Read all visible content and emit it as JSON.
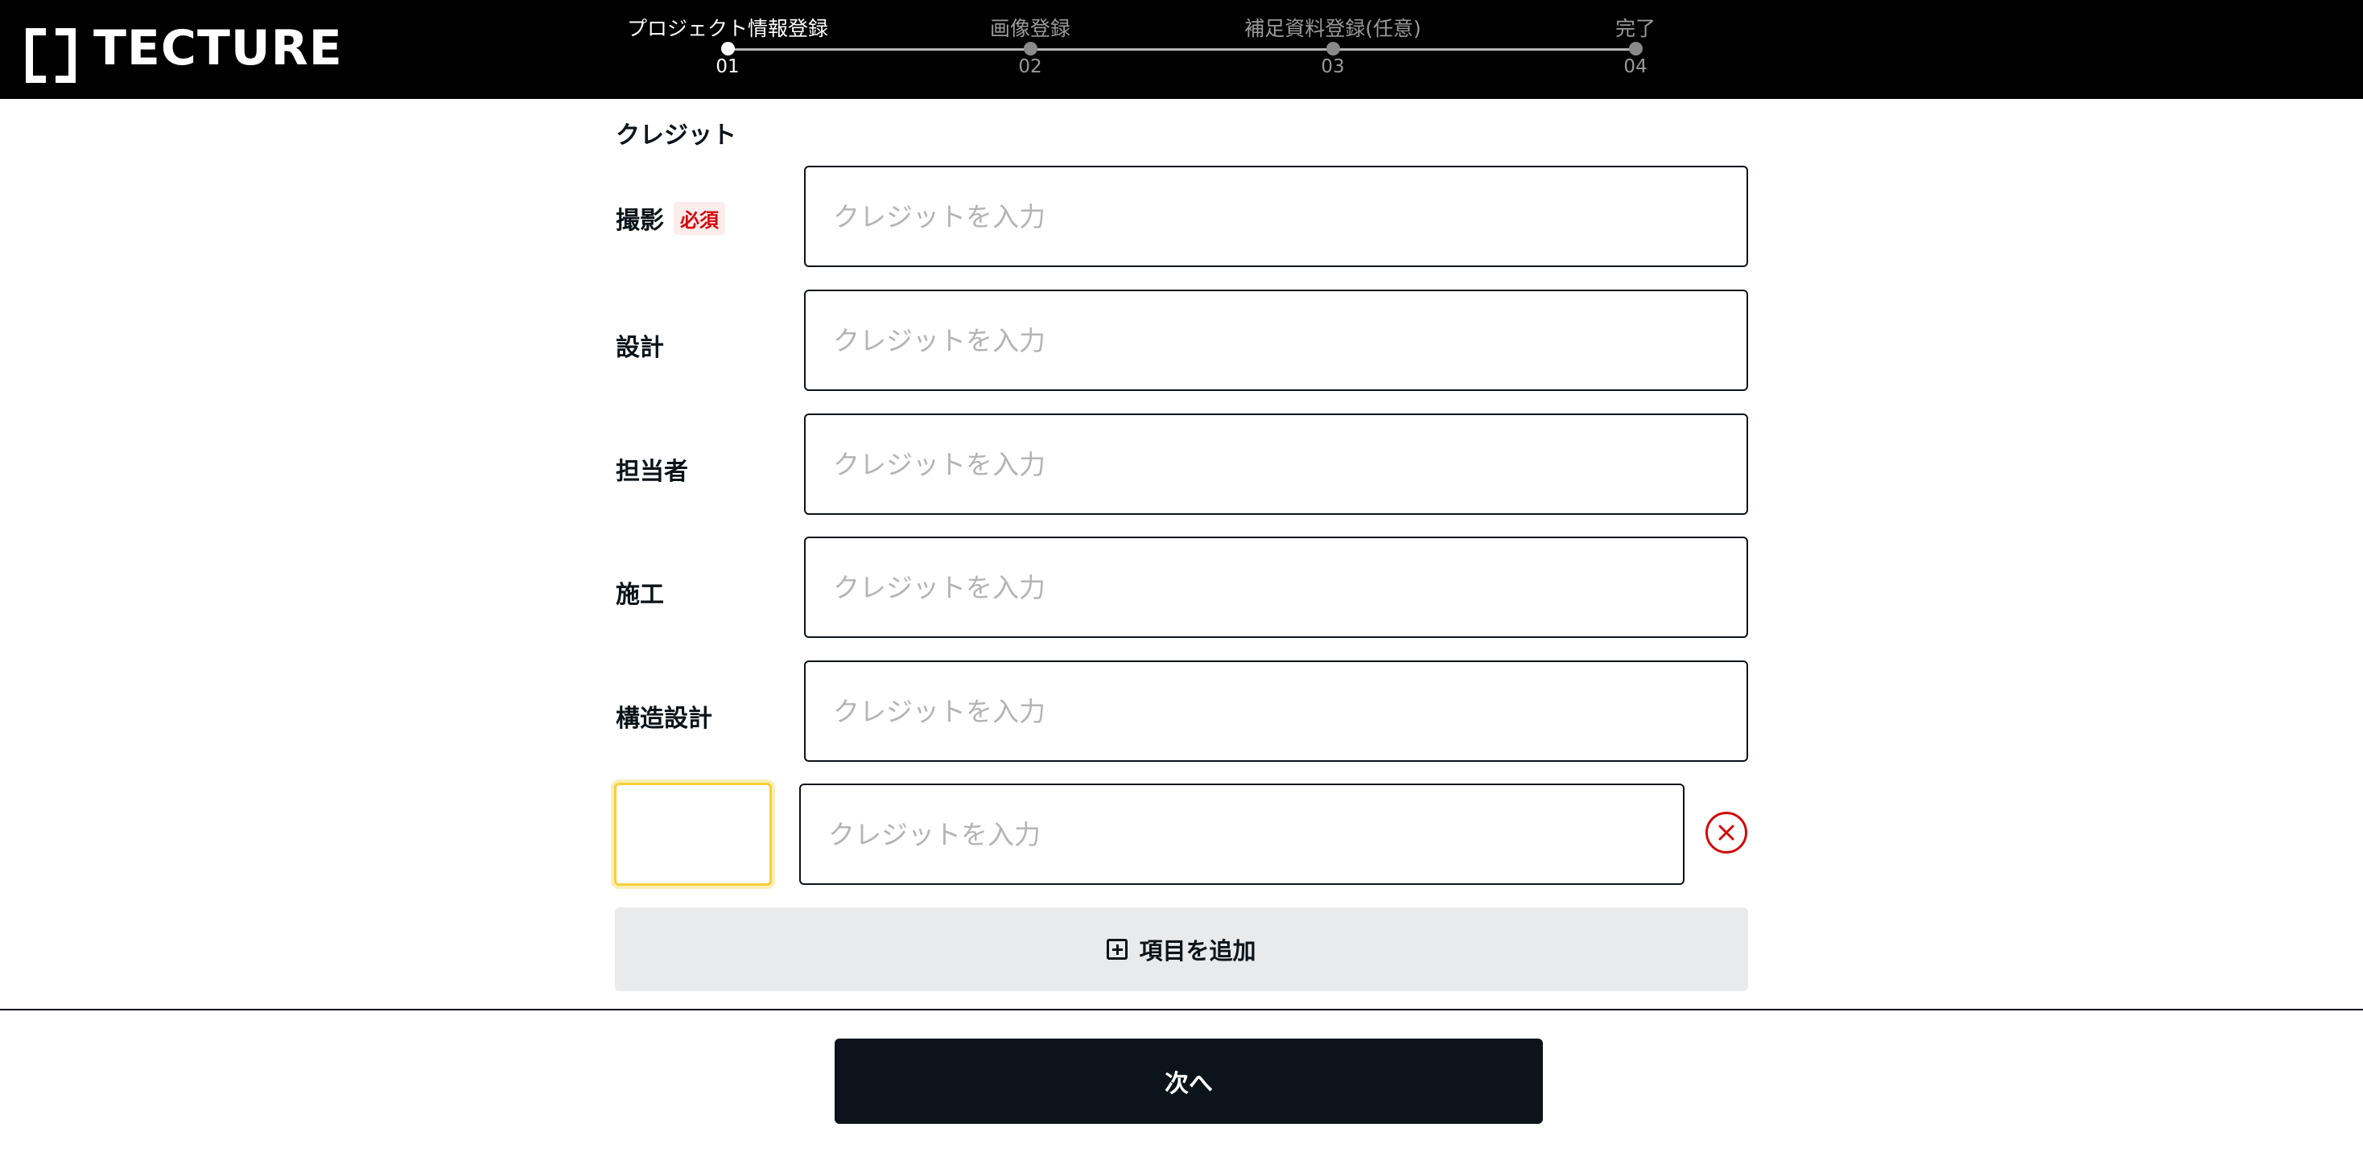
{
  "header": {
    "logo_text": "TECTURE",
    "steps": [
      {
        "label": "プロジェクト情報登録",
        "number": "01",
        "active": true
      },
      {
        "label": "画像登録",
        "number": "02",
        "active": false
      },
      {
        "label": "補足資料登録(任意)",
        "number": "03",
        "active": false
      },
      {
        "label": "完了",
        "number": "04",
        "active": false
      }
    ]
  },
  "credits": {
    "section_title": "クレジット",
    "required_badge": "必須",
    "placeholder": "クレジットを入力",
    "rows": [
      {
        "label": "撮影",
        "required": true,
        "value": ""
      },
      {
        "label": "設計",
        "required": false,
        "value": ""
      },
      {
        "label": "担当者",
        "required": false,
        "value": ""
      },
      {
        "label": "施工",
        "required": false,
        "value": ""
      },
      {
        "label": "構造設計",
        "required": false,
        "value": ""
      }
    ],
    "custom_row": {
      "key_value": "",
      "value": ""
    },
    "add_item_label": "項目を追加"
  },
  "footer": {
    "next_label": "次へ"
  },
  "colors": {
    "header_bg": "#000000",
    "required_red": "#d10a0a",
    "focus_yellow": "#f5cf3a",
    "primary_dark": "#0a141a",
    "add_bg": "#e9eaeb"
  }
}
